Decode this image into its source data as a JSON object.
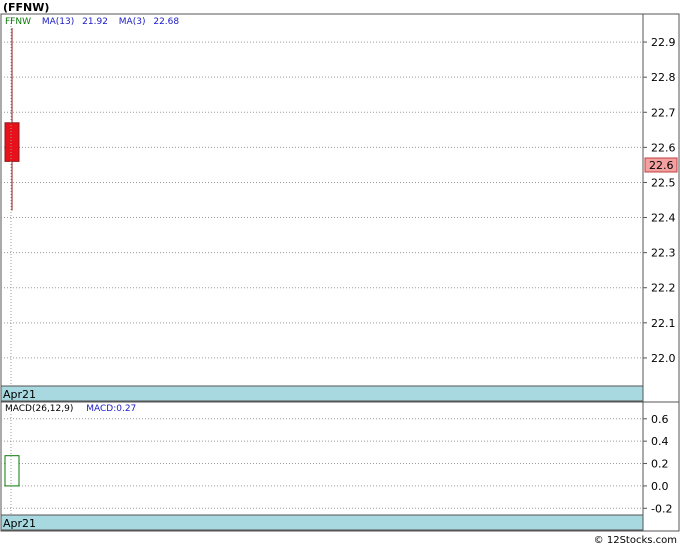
{
  "chart_data": [
    {
      "type": "candlestick",
      "title": "(FFNW)",
      "symbol": "FFNW",
      "legend": [
        {
          "label": "FFNW",
          "color": "#0a7a0a"
        },
        {
          "label": "MA(13)",
          "color": "#1a1ac8"
        },
        {
          "label": "21.92",
          "color": "#1a1ac8"
        },
        {
          "label": "MA(3)",
          "color": "#1a1ac8"
        },
        {
          "label": "22.68",
          "color": "#1a1ac8"
        }
      ],
      "y_ticks": [
        "22.9",
        "22.8",
        "22.7",
        "22.6",
        "22.5",
        "22.4",
        "22.3",
        "22.2",
        "22.1",
        "22.0"
      ],
      "ylim": [
        21.92,
        22.98
      ],
      "candles": [
        {
          "x": "Apr21",
          "open": 22.67,
          "high": 22.94,
          "low": 22.42,
          "close": 22.56,
          "color": "#e8101a"
        }
      ],
      "last_price": "22.6",
      "last_price_bg": "#f2a0a0",
      "x_label": "Apr21"
    },
    {
      "type": "bar",
      "title": "MACD(26,12,9)",
      "legend": [
        {
          "label": "MACD(26,12,9)",
          "color": "#000000"
        },
        {
          "label": "MACD:0.27",
          "color": "#1a1ac8"
        }
      ],
      "y_ticks": [
        "0.6",
        "0.4",
        "0.2",
        "0.0",
        "-0.2"
      ],
      "ylim": [
        -0.26,
        0.75
      ],
      "bars": [
        {
          "x": "Apr21",
          "value": 0.27,
          "color": "#0a7a0a"
        }
      ],
      "x_label": "Apr21"
    }
  ],
  "footer": "© 12Stocks.com",
  "colors": {
    "grid": "#9a9a9a",
    "axis_band": "#a8d8e0",
    "frame": "#555555"
  }
}
